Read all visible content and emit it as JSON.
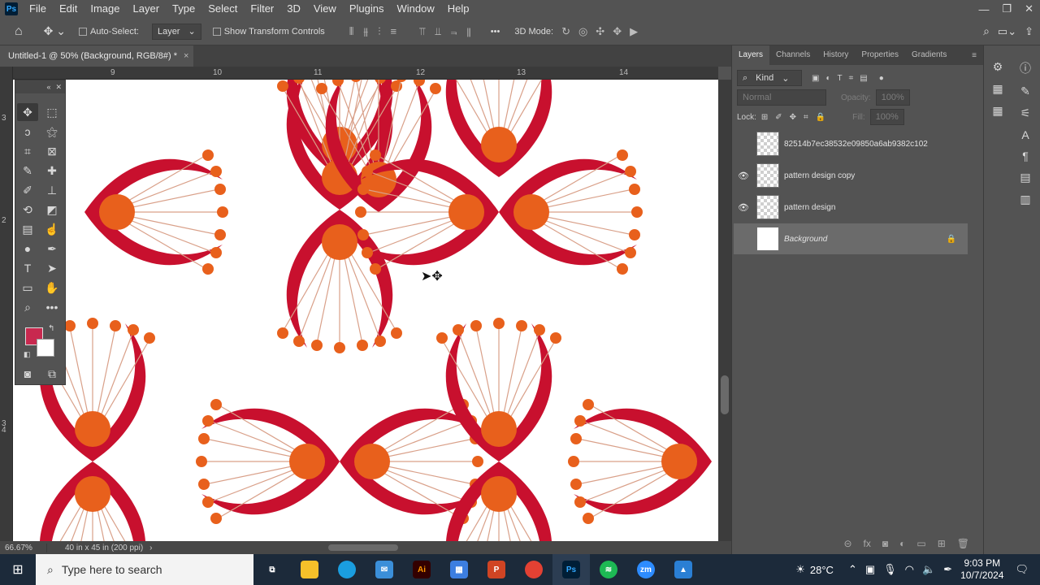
{
  "menubar": {
    "logo": "Ps",
    "items": [
      "File",
      "Edit",
      "Image",
      "Layer",
      "Type",
      "Select",
      "Filter",
      "3D",
      "View",
      "Plugins",
      "Window",
      "Help"
    ],
    "window_controls": [
      "—",
      "❐",
      "✕"
    ]
  },
  "options": {
    "auto_select_label": "Auto-Select:",
    "layer_select_value": "Layer",
    "show_transform_label": "Show Transform Controls",
    "more": "•••",
    "mode_label": "3D Mode:"
  },
  "document": {
    "tab_title": "Untitled-1 @ 50% (Background, RGB/8#) *",
    "tab_close": "×",
    "ruler_top_labels": [
      "9",
      "10",
      "11",
      "12",
      "13",
      "14"
    ],
    "ruler_left_labels": [
      "3",
      "2",
      "3",
      "4"
    ]
  },
  "status": {
    "zoom": "66.67%",
    "doc_info": "40 in x 45 in (200 ppi)"
  },
  "panels": {
    "tabs": [
      "Layers",
      "Channels",
      "History",
      "Properties",
      "Gradients"
    ],
    "active_tab": "Layers",
    "filter_kind": "Kind",
    "blend_mode": "Normal",
    "opacity_label": "Opacity:",
    "opacity_value": "100%",
    "lock_label": "Lock:",
    "fill_label": "Fill:",
    "fill_value": "100%",
    "layers": [
      {
        "name": "82514b7ec38532e09850a6ab9382c102",
        "visible": false,
        "selected": false,
        "locked": false,
        "thumb": "transparent"
      },
      {
        "name": "pattern design copy",
        "visible": true,
        "selected": false,
        "locked": false,
        "thumb": "transparent"
      },
      {
        "name": "pattern design",
        "visible": true,
        "selected": false,
        "locked": false,
        "thumb": "transparent"
      },
      {
        "name": "Background",
        "visible": false,
        "selected": true,
        "locked": true,
        "thumb": "white"
      }
    ]
  },
  "tools": {
    "foreground_color": "#c8294f",
    "background_color": "#ffffff"
  },
  "pattern_colors": {
    "crimson": "#c8102e",
    "orange": "#e8601c",
    "stem": "#d9a089"
  },
  "taskbar": {
    "search_placeholder": "Type here to search",
    "weather": "28°C",
    "time": "9:03 PM",
    "date": "10/7/2024"
  }
}
